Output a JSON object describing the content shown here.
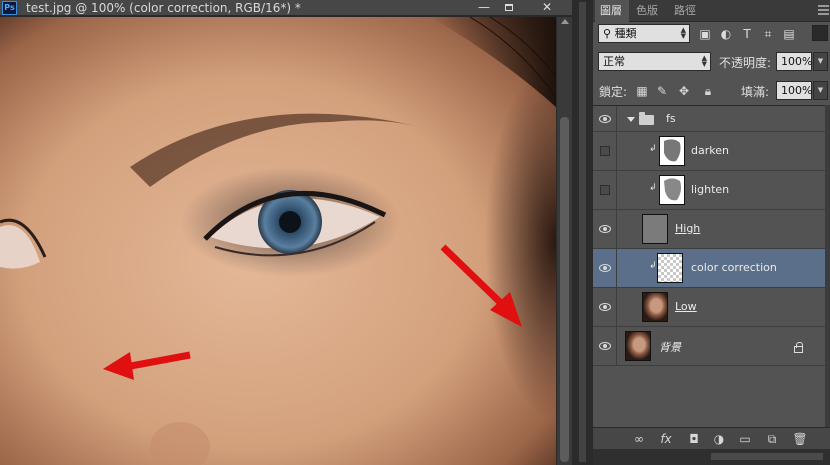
{
  "window": {
    "app_icon": "Ps",
    "title": "test.jpg @ 100% (color correction, RGB/16*) *",
    "min_label": "—",
    "close_label": "✕"
  },
  "canvas": {
    "description_colors": {
      "skin": "#d7a785",
      "arrow": "#e01010",
      "iris": "#4a6b8a"
    }
  },
  "panel": {
    "tabs": [
      {
        "label": "圖層",
        "active": true
      },
      {
        "label": "色版",
        "active": false
      },
      {
        "label": "路徑",
        "active": false
      }
    ],
    "filter": {
      "label": "種類"
    },
    "filter_icons": [
      "image-filter-icon",
      "adjustment-filter-icon",
      "type-filter-icon",
      "shape-filter-icon",
      "smart-object-filter-icon"
    ],
    "blend_mode": "正常",
    "opacity_label": "不透明度:",
    "opacity_value": "100%",
    "lock_label": "鎖定:",
    "fill_label": "填滿:",
    "fill_value": "100%",
    "layers": [
      {
        "name": "fs",
        "type": "group",
        "visible": true,
        "selected": false
      },
      {
        "name": "darken",
        "type": "mask",
        "visible": false,
        "selected": false,
        "clipped": true
      },
      {
        "name": "lighten",
        "type": "mask",
        "visible": false,
        "selected": false,
        "clipped": true
      },
      {
        "name": "High",
        "type": "gray",
        "visible": true,
        "selected": false,
        "underline": true
      },
      {
        "name": "color correction",
        "type": "transparent",
        "visible": true,
        "selected": true,
        "clipped": true
      },
      {
        "name": "Low",
        "type": "photo",
        "visible": true,
        "selected": false,
        "underline": true
      },
      {
        "name": "背景",
        "type": "photo",
        "visible": true,
        "selected": false,
        "italic": true,
        "locked": true
      }
    ],
    "footer_icons": [
      "link-layers-icon",
      "fx-icon",
      "add-mask-icon",
      "adjustment-layer-icon",
      "new-group-icon",
      "new-layer-icon",
      "trash-icon"
    ],
    "footer_fx": "fx"
  }
}
